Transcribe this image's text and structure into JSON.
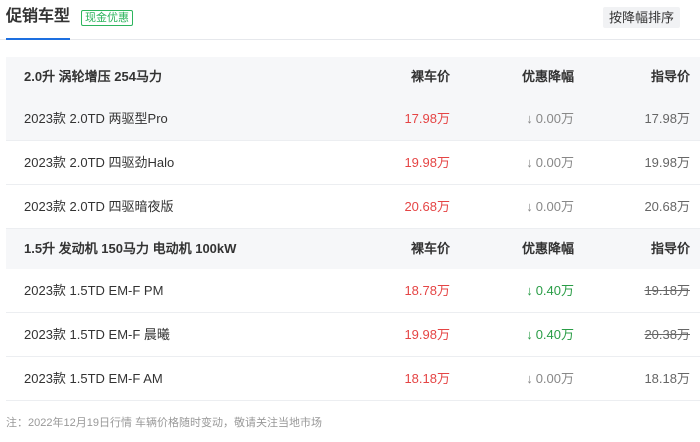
{
  "header": {
    "title": "促销车型",
    "badge": "现金优惠",
    "sort_button": "按降幅排序",
    "accent_color": "#1d6fe0",
    "badge_color": "#2db55d"
  },
  "groups": [
    {
      "engine": "2.0升 涡轮增压 254马力",
      "col_price": "裸车价",
      "col_drop": "优惠降幅",
      "col_guide": "指导价",
      "rows": [
        {
          "name": "2023款 2.0TD 两驱型Pro",
          "price": "17.98万",
          "drop": "0.00万",
          "drop_dir": "zero",
          "guide": "17.98万",
          "guide_struck": false
        },
        {
          "name": "2023款 2.0TD 四驱劲Halo",
          "price": "19.98万",
          "drop": "0.00万",
          "drop_dir": "zero",
          "guide": "19.98万",
          "guide_struck": false
        },
        {
          "name": "2023款 2.0TD 四驱暗夜版",
          "price": "20.68万",
          "drop": "0.00万",
          "drop_dir": "zero",
          "guide": "20.68万",
          "guide_struck": false
        }
      ]
    },
    {
      "engine": "1.5升 发动机 150马力 电动机 100kW",
      "col_price": "裸车价",
      "col_drop": "优惠降幅",
      "col_guide": "指导价",
      "rows": [
        {
          "name": "2023款 1.5TD EM-F PM",
          "price": "18.78万",
          "drop": "0.40万",
          "drop_dir": "down-green",
          "guide": "19.18万",
          "guide_struck": true
        },
        {
          "name": "2023款 1.5TD EM-F 晨曦",
          "price": "19.98万",
          "drop": "0.40万",
          "drop_dir": "down-green",
          "guide": "20.38万",
          "guide_struck": true
        },
        {
          "name": "2023款 1.5TD EM-F AM",
          "price": "18.18万",
          "drop": "0.00万",
          "drop_dir": "zero",
          "guide": "18.18万",
          "guide_struck": false
        }
      ]
    }
  ],
  "icons": {
    "drop_arrow": "arrow-down-icon"
  },
  "footnote": "注：2022年12月19日行情 车辆价格随时变动，敬请关注当地市场"
}
